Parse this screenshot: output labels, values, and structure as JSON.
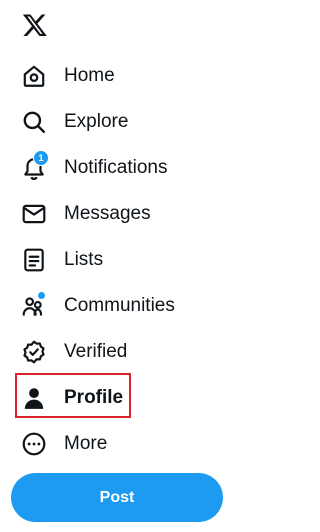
{
  "app": {
    "logo_icon": "x-logo-icon"
  },
  "nav": {
    "items": [
      {
        "label": "Home",
        "icon": "home-icon"
      },
      {
        "label": "Explore",
        "icon": "search-icon"
      },
      {
        "label": "Notifications",
        "icon": "bell-icon",
        "badge": "1"
      },
      {
        "label": "Messages",
        "icon": "envelope-icon"
      },
      {
        "label": "Lists",
        "icon": "list-icon"
      },
      {
        "label": "Communities",
        "icon": "communities-icon"
      },
      {
        "label": "Verified",
        "icon": "verified-badge-icon"
      },
      {
        "label": "Profile",
        "icon": "person-icon"
      },
      {
        "label": "More",
        "icon": "more-circle-icon"
      }
    ]
  },
  "post_button": {
    "label": "Post"
  },
  "colors": {
    "accent": "#1d9bf0",
    "text": "#0f1419",
    "highlight": "#d9232d",
    "background": "#ffffff"
  }
}
